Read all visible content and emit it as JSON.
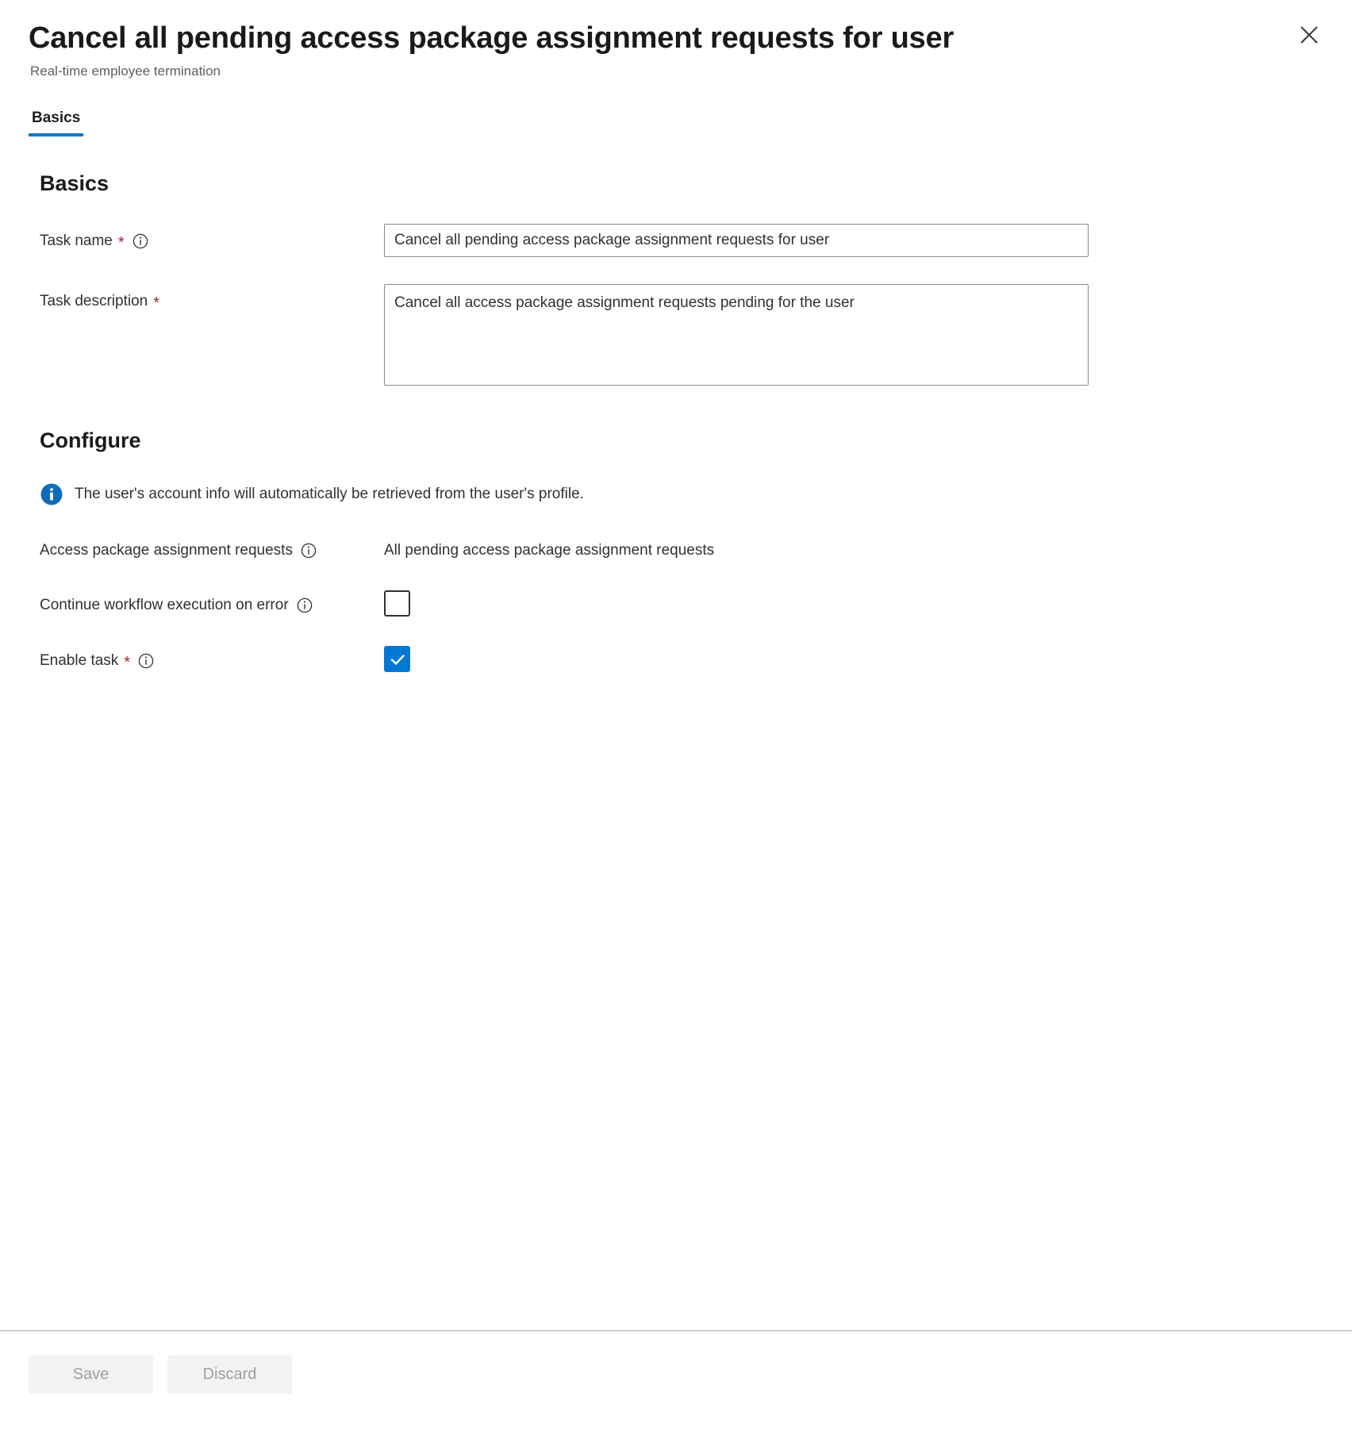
{
  "header": {
    "title": "Cancel all pending access package assignment requests for user",
    "subtitle": "Real-time employee termination",
    "close_icon": "close-icon"
  },
  "tabs": [
    {
      "label": "Basics",
      "active": true
    }
  ],
  "basics": {
    "heading": "Basics",
    "task_name": {
      "label": "Task name",
      "required_marker": "*",
      "info_icon": "info-circle-icon",
      "value": "Cancel all pending access package assignment requests for user",
      "placeholder": ""
    },
    "task_description": {
      "label": "Task description",
      "required_marker": "*",
      "value": "Cancel all access package assignment requests pending for the user",
      "placeholder": ""
    }
  },
  "configure": {
    "heading": "Configure",
    "info_banner": {
      "icon": "info-filled-icon",
      "text": "The user's account info will automatically be retrieved from the user's profile."
    },
    "assignment_requests": {
      "label": "Access package assignment requests",
      "info_icon": "info-circle-icon",
      "value": "All pending access package assignment requests"
    },
    "continue_on_error": {
      "label": "Continue workflow execution on error",
      "info_icon": "info-circle-icon",
      "checked": false
    },
    "enable_task": {
      "label": "Enable task",
      "required_marker": "*",
      "info_icon": "info-circle-icon",
      "checked": true
    }
  },
  "footer": {
    "save_label": "Save",
    "discard_label": "Discard"
  },
  "colors": {
    "accent": "#0078d4",
    "required": "#a4262c",
    "text": "#323130",
    "subtle_text": "#605e5c",
    "border": "#8a8886",
    "disabled_button_bg": "#f3f2f1",
    "disabled_button_text": "#a19f9d"
  }
}
